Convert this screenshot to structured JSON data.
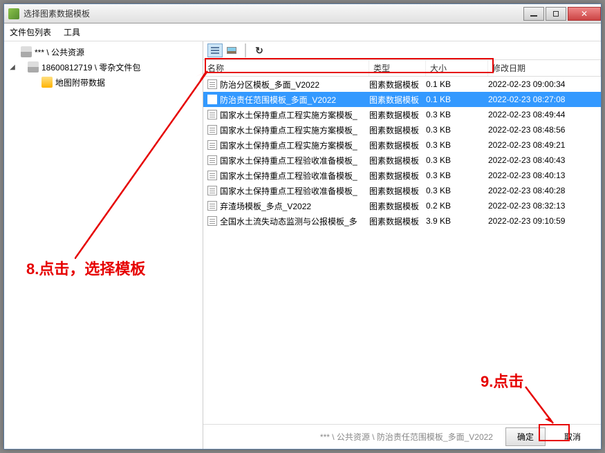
{
  "window": {
    "title": "选择图素数据模板"
  },
  "menu": {
    "filelist": "文件包列表",
    "tools": "工具"
  },
  "tree": {
    "root": "*** \\ 公共资源",
    "node1": "18600812719 \\ 零杂文件包",
    "node2": "地图附带数据"
  },
  "columns": {
    "name": "名称",
    "type": "类型",
    "size": "大小",
    "date": "修改日期"
  },
  "rows": [
    {
      "name": "防治分区模板_多面_V2022",
      "type": "图素数据模板",
      "size": "0.1 KB",
      "date": "2022-02-23 09:00:34"
    },
    {
      "name": "防治责任范围模板_多面_V2022",
      "type": "图素数据模板",
      "size": "0.1 KB",
      "date": "2022-02-23 08:27:08"
    },
    {
      "name": "国家水土保持重点工程实施方案模板_",
      "type": "图素数据模板",
      "size": "0.3 KB",
      "date": "2022-02-23 08:49:44"
    },
    {
      "name": "国家水土保持重点工程实施方案模板_",
      "type": "图素数据模板",
      "size": "0.3 KB",
      "date": "2022-02-23 08:48:56"
    },
    {
      "name": "国家水土保持重点工程实施方案模板_",
      "type": "图素数据模板",
      "size": "0.3 KB",
      "date": "2022-02-23 08:49:21"
    },
    {
      "name": "国家水土保持重点工程验收准备模板_",
      "type": "图素数据模板",
      "size": "0.3 KB",
      "date": "2022-02-23 08:40:43"
    },
    {
      "name": "国家水土保持重点工程验收准备模板_",
      "type": "图素数据模板",
      "size": "0.3 KB",
      "date": "2022-02-23 08:40:13"
    },
    {
      "name": "国家水土保持重点工程验收准备模板_",
      "type": "图素数据模板",
      "size": "0.3 KB",
      "date": "2022-02-23 08:40:28"
    },
    {
      "name": "弃渣场模板_多点_V2022",
      "type": "图素数据模板",
      "size": "0.2 KB",
      "date": "2022-02-23 08:32:13"
    },
    {
      "name": "全国水土流失动态监测与公报模板_多",
      "type": "图素数据模板",
      "size": "3.9 KB",
      "date": "2022-02-23 09:10:59"
    }
  ],
  "selected_index": 1,
  "footer": {
    "path": "*** \\ 公共资源 \\ 防治责任范围模板_多面_V2022",
    "ok": "确定",
    "cancel": "取消"
  },
  "annotations": {
    "a1": "8.点击，选择模板",
    "a2": "9.点击"
  }
}
